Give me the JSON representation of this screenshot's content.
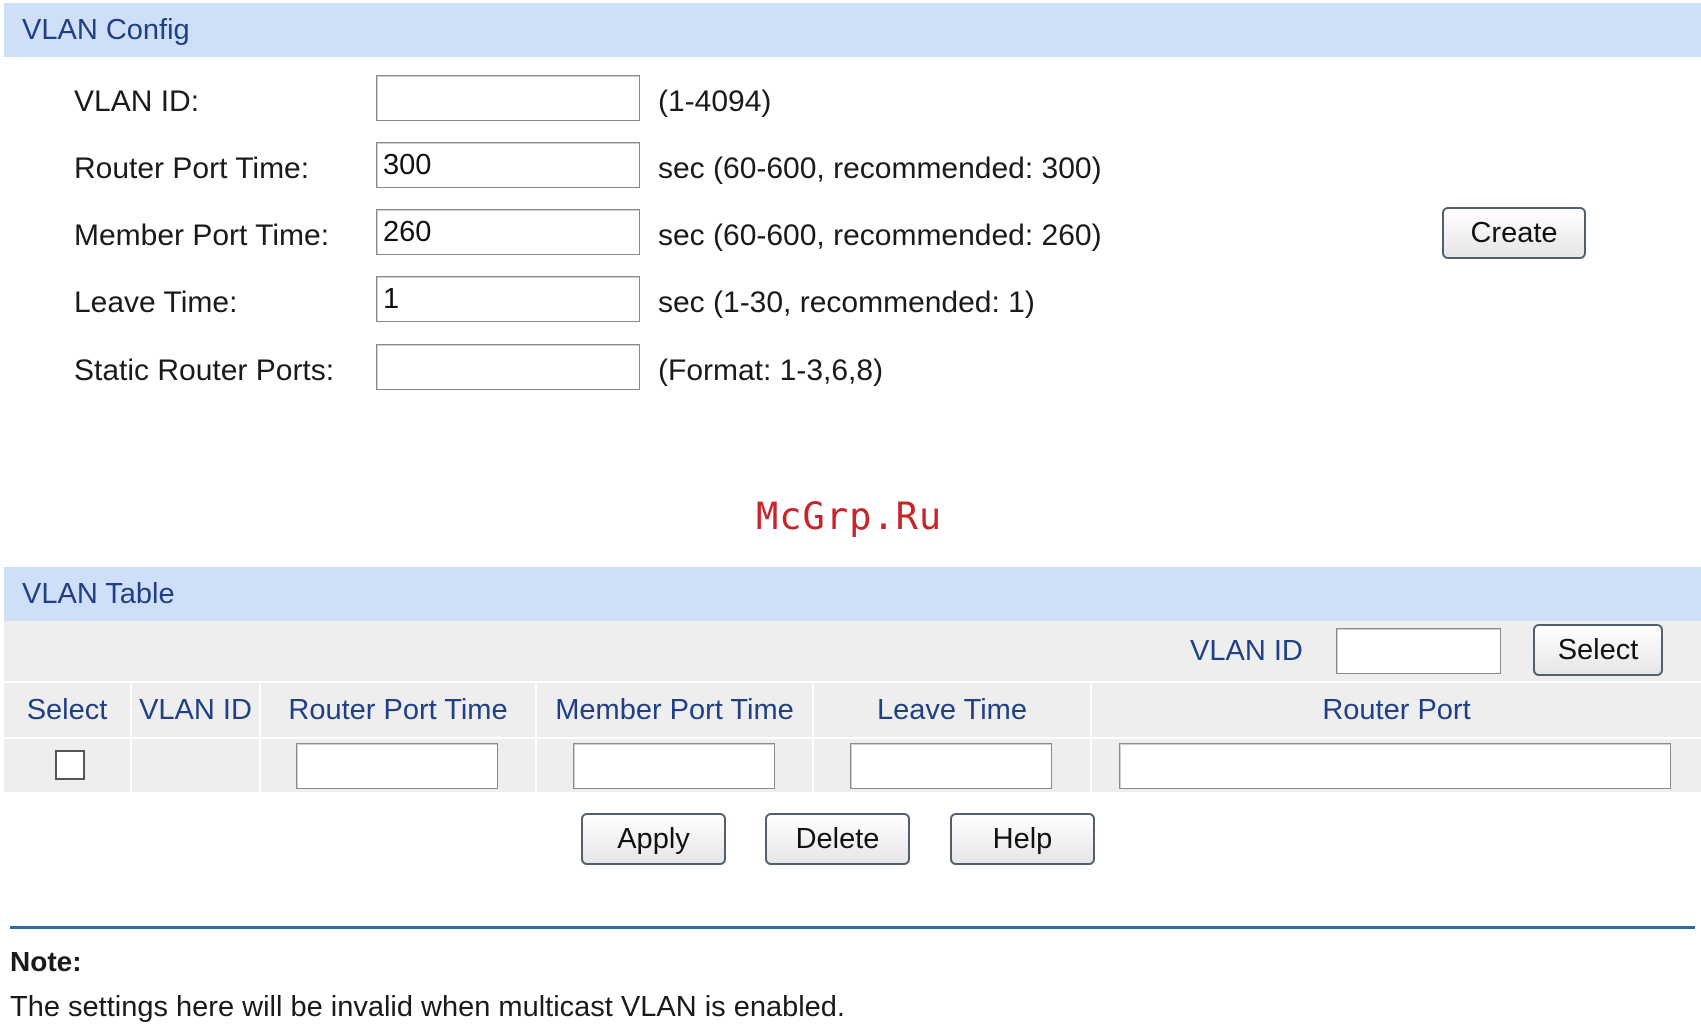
{
  "vlan_config": {
    "header": "VLAN Config",
    "fields": [
      {
        "label": "VLAN ID:",
        "value": "",
        "hint": "(1-4094)"
      },
      {
        "label": "Router Port Time:",
        "value": "300",
        "hint": "sec (60-600, recommended: 300)"
      },
      {
        "label": "Member Port Time:",
        "value": "260",
        "hint": "sec (60-600, recommended: 260)"
      },
      {
        "label": "Leave Time:",
        "value": "1",
        "hint": "sec (1-30, recommended: 1)"
      },
      {
        "label": "Static Router Ports:",
        "value": "",
        "hint": "(Format: 1-3,6,8)"
      }
    ],
    "create_label": "Create"
  },
  "watermark": "McGrp.Ru",
  "vlan_table": {
    "header": "VLAN Table",
    "search_label": "VLAN ID",
    "search_value": "",
    "select_label": "Select",
    "columns": [
      "Select",
      "VLAN ID",
      "Router Port Time",
      "Member Port Time",
      "Leave Time",
      "Router Port"
    ],
    "row": {
      "vlan_id": "",
      "router_port_time": "",
      "member_port_time": "",
      "leave_time": "",
      "router_port": "",
      "checked": false
    }
  },
  "actions": {
    "apply_label": "Apply",
    "delete_label": "Delete",
    "help_label": "Help"
  },
  "note": {
    "title": "Note:",
    "text": "The settings here will be invalid when multicast VLAN is enabled."
  },
  "colors": {
    "header_bg": "#cfdff7",
    "header_text": "#1f3f86",
    "table_bg": "#eeeeee",
    "rule": "#2f6aa6",
    "watermark": "#c9242a"
  }
}
